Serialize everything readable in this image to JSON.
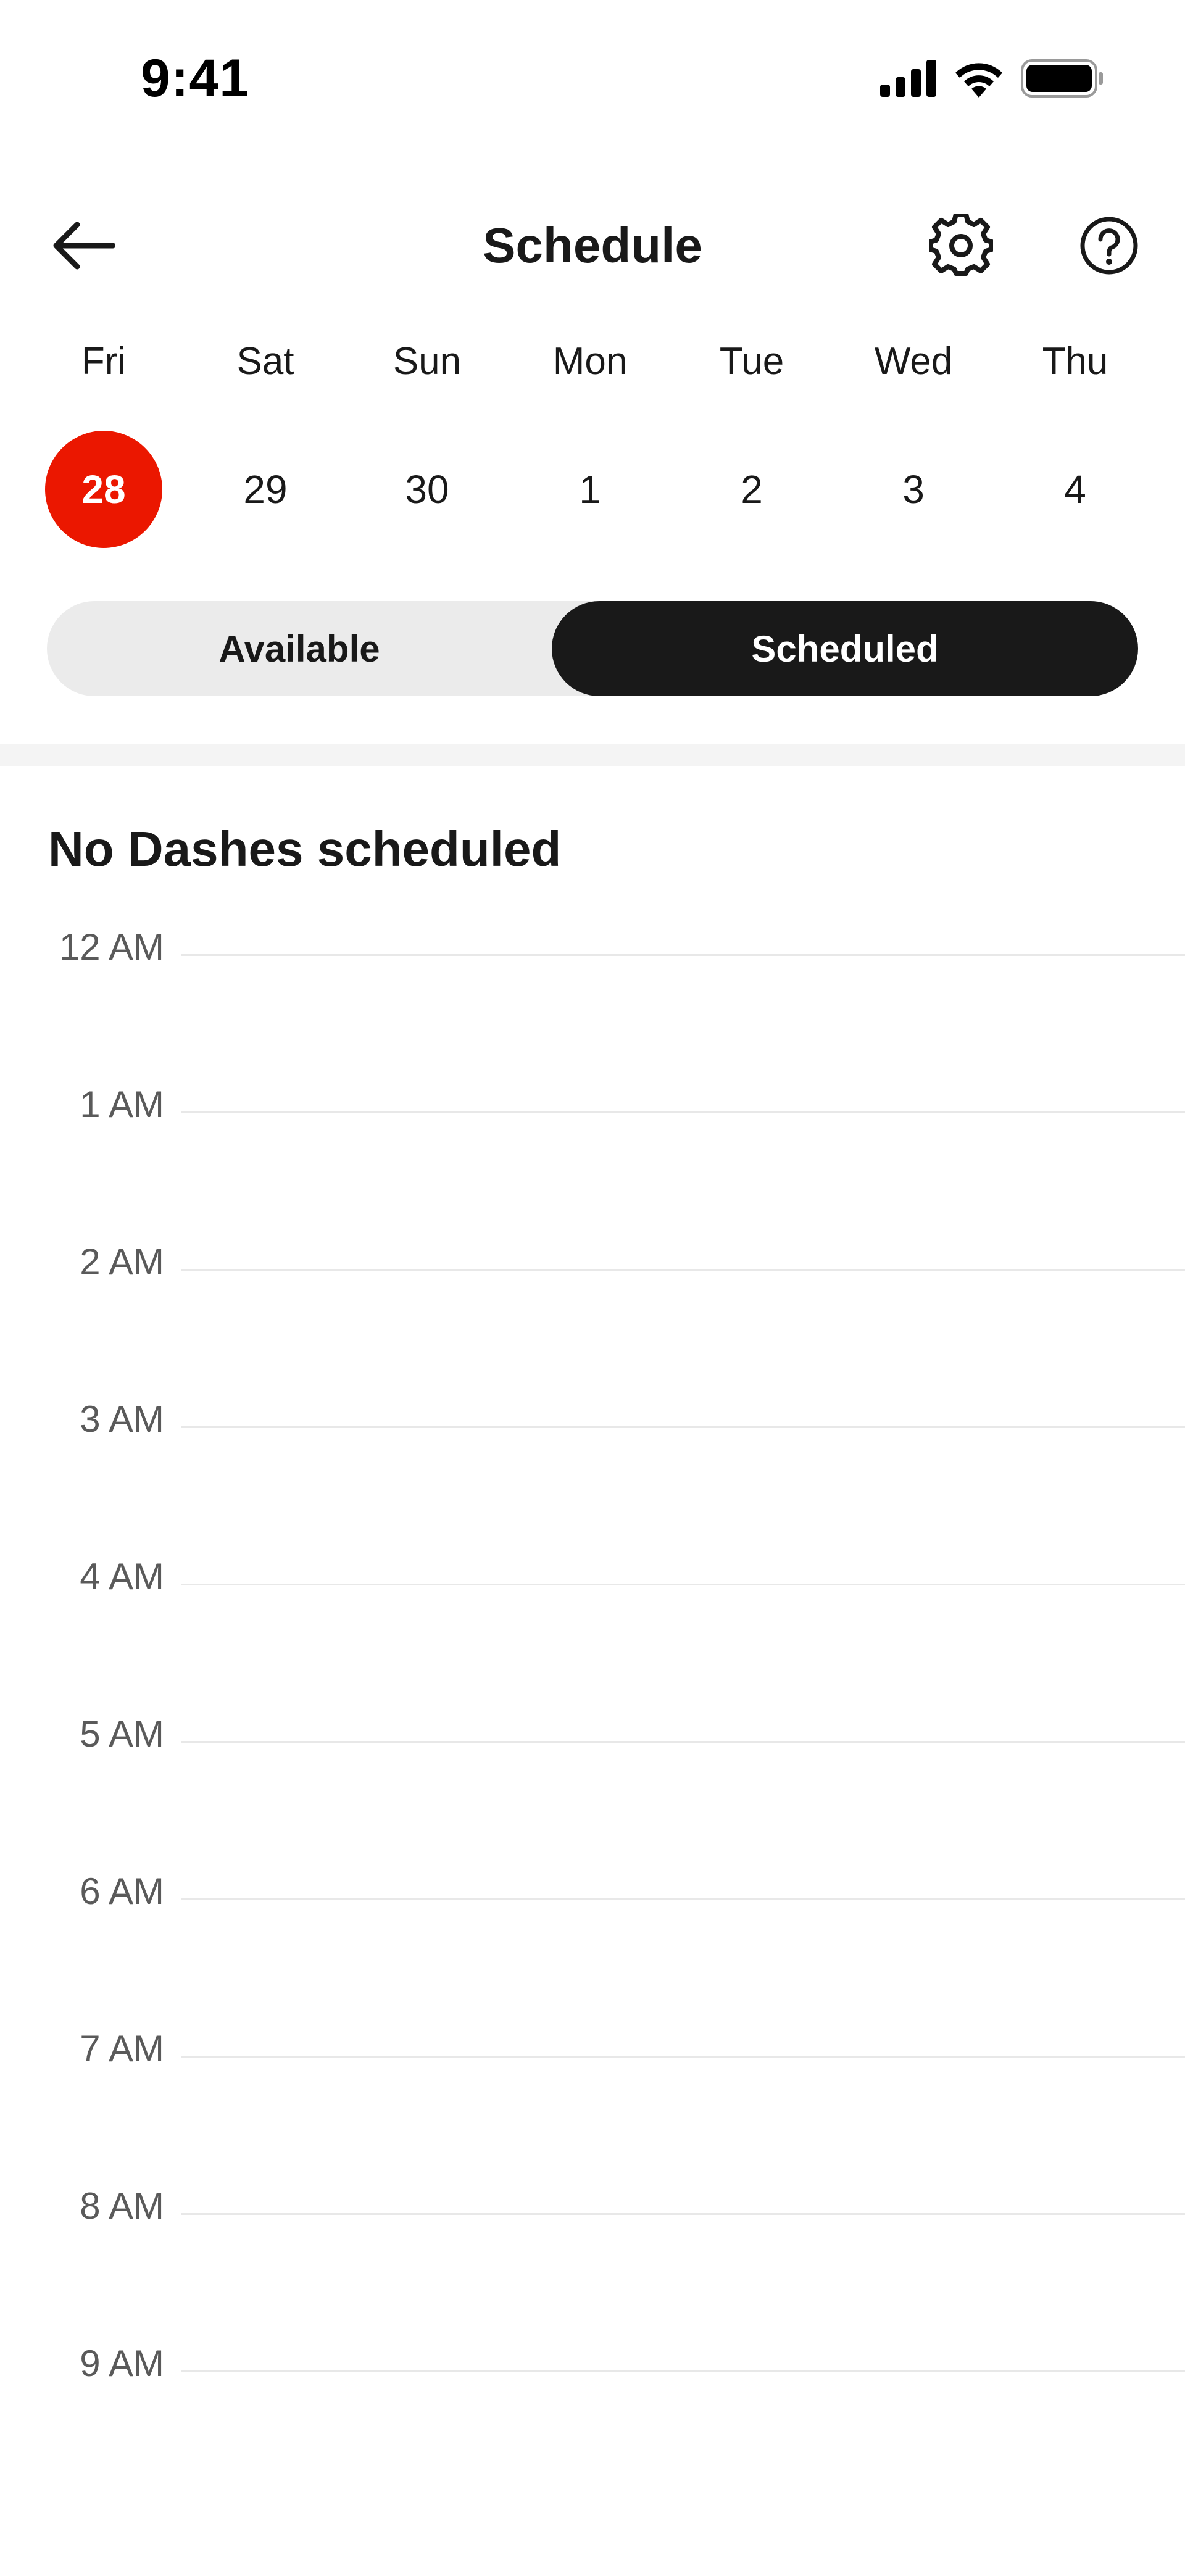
{
  "status_bar": {
    "time": "9:41",
    "icons": [
      "cellular-signal-icon",
      "wifi-icon",
      "battery-icon"
    ]
  },
  "header": {
    "title": "Schedule",
    "back_icon": "arrow-left-icon",
    "settings_icon": "gear-icon",
    "help_icon": "question-circle-icon"
  },
  "week": {
    "days": [
      {
        "name": "Fri",
        "date": "28",
        "selected": true
      },
      {
        "name": "Sat",
        "date": "29",
        "selected": false
      },
      {
        "name": "Sun",
        "date": "30",
        "selected": false
      },
      {
        "name": "Mon",
        "date": "1",
        "selected": false
      },
      {
        "name": "Tue",
        "date": "2",
        "selected": false
      },
      {
        "name": "Wed",
        "date": "3",
        "selected": false
      },
      {
        "name": "Thu",
        "date": "4",
        "selected": false
      }
    ],
    "selected_color": "#eb1700"
  },
  "segmented": {
    "available_label": "Available",
    "scheduled_label": "Scheduled",
    "active": "Scheduled"
  },
  "content": {
    "empty_title": "No Dashes scheduled",
    "hours": [
      "12 AM",
      "1 AM",
      "2 AM",
      "3 AM",
      "4 AM",
      "5 AM",
      "6 AM",
      "7 AM",
      "8 AM",
      "9 AM"
    ]
  },
  "colors": {
    "text": "#191919",
    "accent": "#eb1700",
    "segment_active_bg": "#191919",
    "segment_bg": "#ebebeb",
    "hour_label": "#5a5a5a"
  }
}
